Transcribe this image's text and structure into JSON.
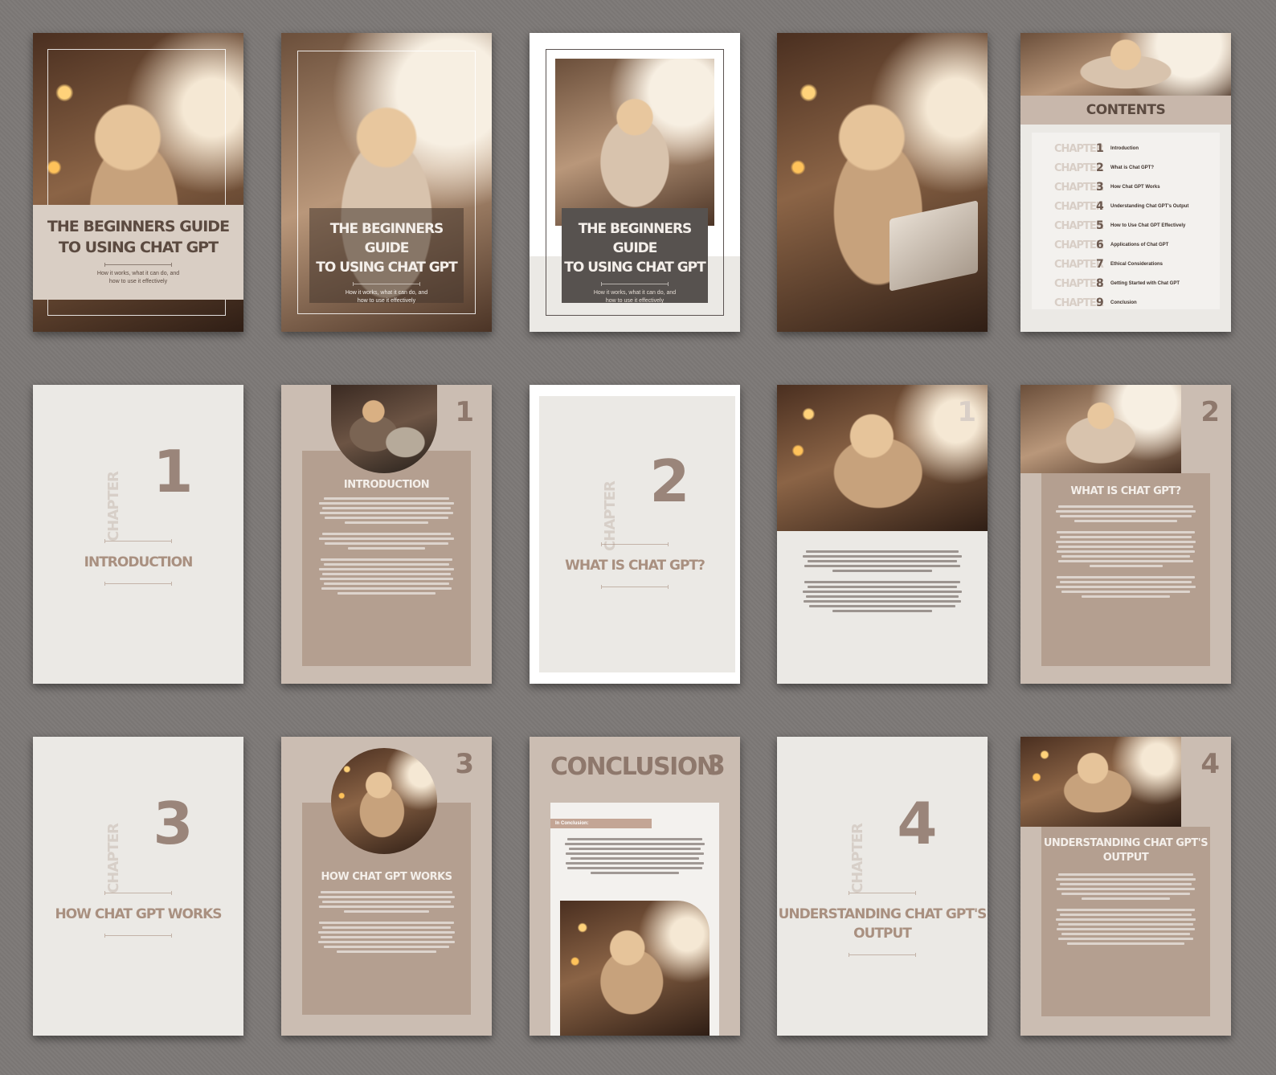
{
  "cover": {
    "title_line1": "THE BEGINNERS GUIDE",
    "title_line2": "TO USING CHAT GPT",
    "subtitle_line1": "How it works, what it can do, and",
    "subtitle_line2": "how to use it effectively"
  },
  "contents": {
    "heading": "CONTENTS",
    "chapter_word": "CHAPTER",
    "items": [
      {
        "num": "1",
        "title": "Introduction"
      },
      {
        "num": "2",
        "title": "What is Chat GPT?"
      },
      {
        "num": "3",
        "title": "How Chat GPT Works"
      },
      {
        "num": "4",
        "title": "Understanding Chat GPT's Output"
      },
      {
        "num": "5",
        "title": "How to Use Chat GPT Effectively"
      },
      {
        "num": "6",
        "title": "Applications of Chat GPT"
      },
      {
        "num": "7",
        "title": "Ethical Considerations"
      },
      {
        "num": "8",
        "title": "Getting Started with Chat GPT"
      },
      {
        "num": "9",
        "title": "Conclusion"
      }
    ]
  },
  "chapters": {
    "word": "CHAPTER",
    "ch1": {
      "num": "1",
      "title": "INTRODUCTION"
    },
    "ch2": {
      "num": "2",
      "title": "WHAT IS CHAT GPT?"
    },
    "ch3": {
      "num": "3",
      "title": "HOW CHAT GPT WORKS"
    },
    "ch4": {
      "num": "4",
      "title_line1": "UNDERSTANDING CHAT GPT'S",
      "title_line2": "OUTPUT"
    }
  },
  "content_pages": {
    "intro_title": "INTRODUCTION",
    "what_title": "WHAT IS CHAT GPT?",
    "how_title": "HOW CHAT GPT WORKS",
    "conclusion_title": "CONCLUSION",
    "conclusion_tag": "In Conclusion:",
    "output_title_line1": "UNDERSTANDING CHAT GPT'S",
    "output_title_line2": "OUTPUT",
    "n1": "1",
    "n2": "2",
    "n3": "3",
    "n4": "4"
  }
}
